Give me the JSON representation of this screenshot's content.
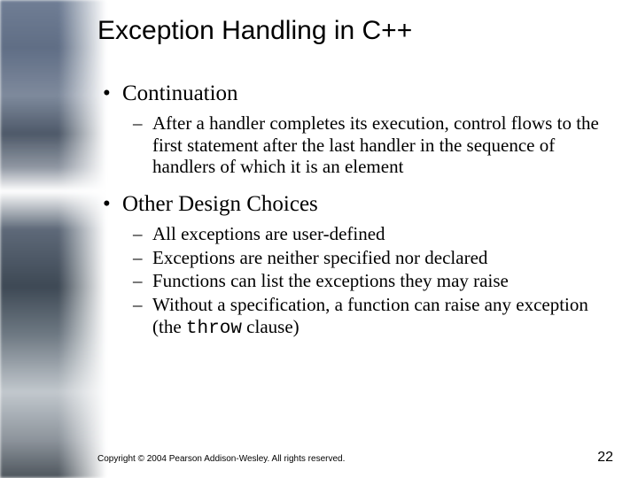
{
  "title": "Exception Handling in C++",
  "bullets": [
    {
      "text": "Continuation",
      "sub": [
        "After a handler completes its execution, control flows to the first statement after the last handler in the sequence of handlers of which it is an element"
      ]
    },
    {
      "text": "Other Design Choices",
      "sub": [
        "All exceptions are user-defined",
        "Exceptions are neither specified nor declared",
        "Functions can list the exceptions they may raise",
        {
          "prefix": "Without a specification, a function can raise any exception (the ",
          "code": "throw",
          "suffix": " clause)"
        }
      ]
    }
  ],
  "footer": {
    "copyright": "Copyright © 2004 Pearson Addison-Wesley. All rights reserved.",
    "page": "22"
  }
}
